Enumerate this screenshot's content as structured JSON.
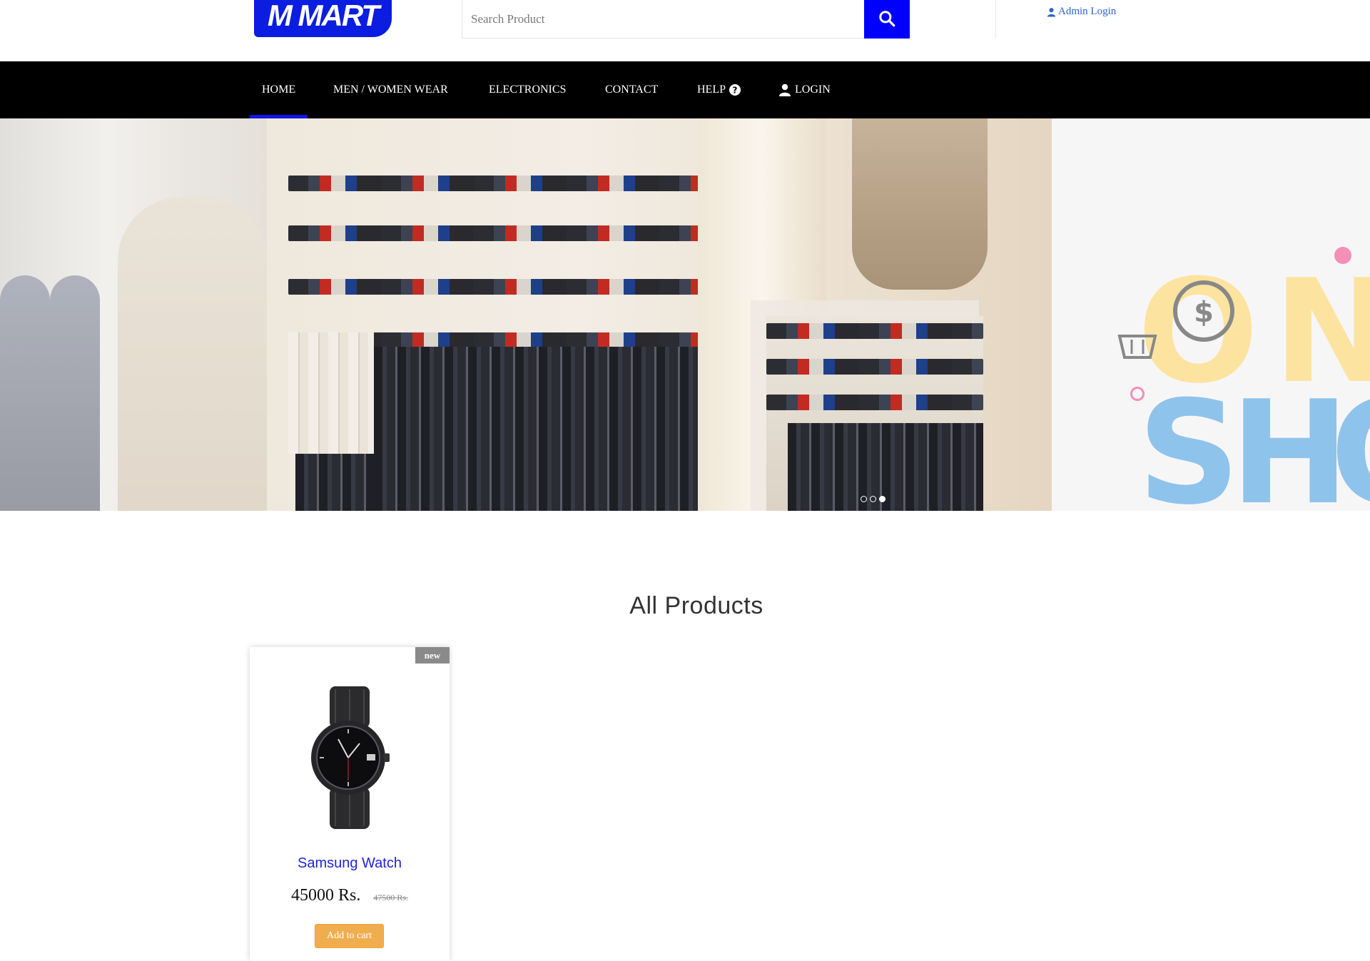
{
  "header": {
    "logo_text": "M MART",
    "search": {
      "placeholder": "Search Product",
      "value": "",
      "button_icon": "search-icon"
    },
    "admin_login": {
      "label": "Admin Login",
      "icon": "user-icon"
    }
  },
  "nav": {
    "items": [
      {
        "label": "HOME",
        "active": true
      },
      {
        "label": "MEN / WOMEN WEAR"
      },
      {
        "label": "ELECTRONICS"
      },
      {
        "label": "CONTACT"
      },
      {
        "label": "HELP",
        "icon": "question-circle-icon"
      },
      {
        "label": "LOGIN",
        "icon": "user-icon"
      }
    ]
  },
  "slider": {
    "slides": 3,
    "active_slide": 3
  },
  "products": {
    "section_title": "All Products",
    "items": [
      {
        "badge": "new",
        "name": "Samsung Watch",
        "price": "45000 Rs.",
        "old_price": "47500 Rs.",
        "cart_label": "Add to cart"
      }
    ]
  },
  "colors": {
    "brand_blue": "#0a1de0",
    "search_button": "#0000ff",
    "nav_bg": "#000000",
    "nav_active_underline": "#1414e6",
    "cart_button": "#f0ad4e",
    "product_name": "#2121e0"
  }
}
